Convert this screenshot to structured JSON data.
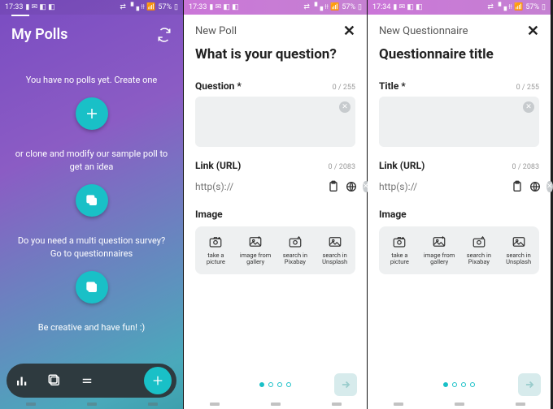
{
  "screens": [
    {
      "status": {
        "time": "17:33",
        "battery": "57%"
      },
      "title": "My Polls",
      "lines": [
        "You have no polls yet. Create one",
        "or clone and modify our sample poll to get an idea",
        "Do you need a multi question survey? Go to questionnaires",
        "Be creative and have fun! :)"
      ]
    },
    {
      "status": {
        "time": "17:33",
        "battery": "57%"
      },
      "header": "New Poll",
      "title": "What is your question?",
      "field_label": "Question *",
      "field_counter": "0 / 255",
      "link_label": "Link (URL)",
      "link_counter": "0 / 2083",
      "link_placeholder": "http(s)://",
      "image_label": "Image",
      "image_opts": [
        "take a picture",
        "image from gallery",
        "search in Pixabay",
        "search in Unsplash"
      ]
    },
    {
      "status": {
        "time": "17:34",
        "battery": "57%"
      },
      "header": "New Questionnaire",
      "title": "Questionnaire title",
      "field_label": "Title *",
      "field_counter": "0 / 255",
      "link_label": "Link (URL)",
      "link_counter": "0 / 2083",
      "link_placeholder": "http(s)://",
      "image_label": "Image",
      "image_opts": [
        "take a picture",
        "image from gallery",
        "search in Pixabay",
        "search in Unsplash"
      ]
    }
  ]
}
